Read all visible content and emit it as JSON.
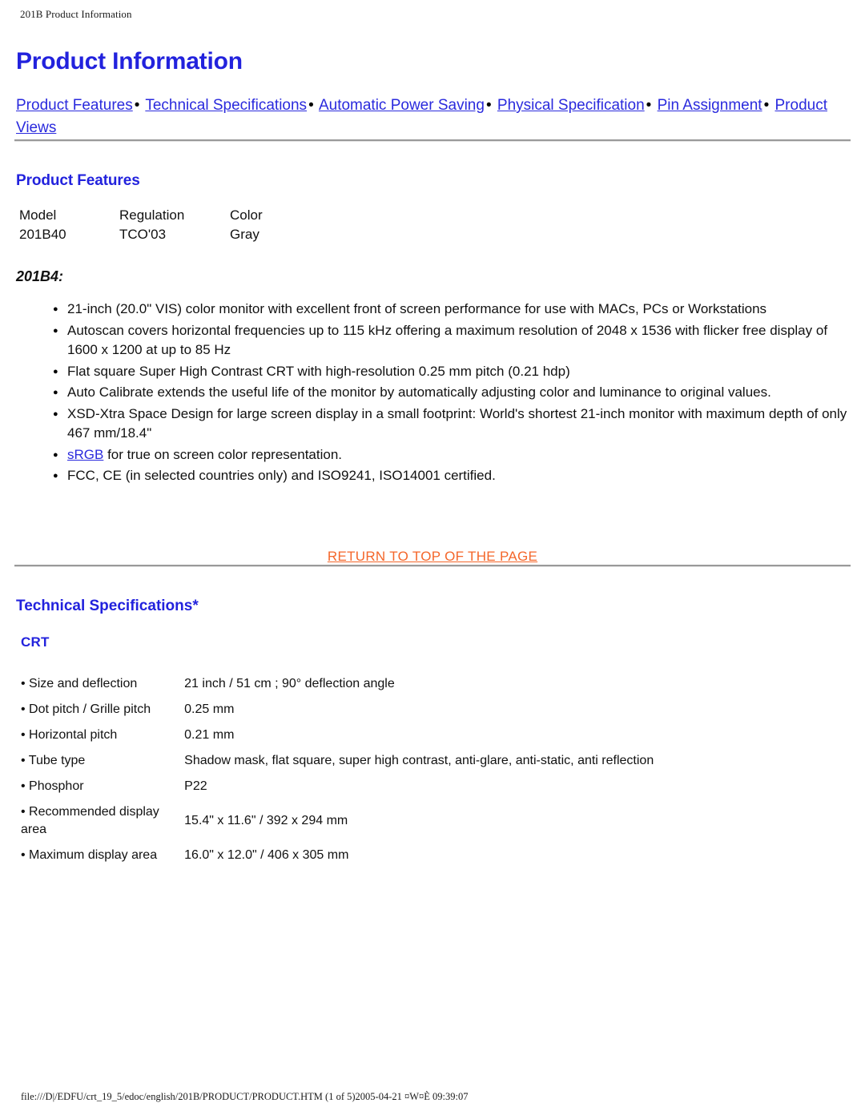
{
  "header": {
    "running_title": "201B Product Information"
  },
  "page": {
    "title": "Product Information"
  },
  "nav": {
    "separator": "•",
    "links": [
      {
        "label": "Product Features"
      },
      {
        "label": "Technical Specifications"
      },
      {
        "label": "Automatic Power Saving"
      },
      {
        "label": "Physical Specification"
      },
      {
        "label": "Pin Assignment"
      },
      {
        "label": "Product Views"
      }
    ]
  },
  "product_features": {
    "heading": "Product Features",
    "table": {
      "columns": [
        "Model",
        "Regulation",
        "Color"
      ],
      "rows": [
        [
          "201B40",
          "TCO'03",
          "Gray"
        ]
      ]
    },
    "model_label": "201B4:",
    "bullets": [
      {
        "text": "21-inch (20.0\" VIS) color monitor with excellent front of screen performance for use with MACs, PCs or Workstations"
      },
      {
        "text": "Autoscan covers horizontal frequencies up to 115 kHz offering a maximum resolution of 2048 x 1536 with flicker free display of 1600 x 1200 at up to 85 Hz"
      },
      {
        "text": "Flat square Super High Contrast CRT with high-resolution 0.25 mm pitch (0.21 hdp)"
      },
      {
        "text": "Auto Calibrate extends the useful life of the monitor by automatically adjusting color and luminance to original values."
      },
      {
        "text": "XSD-Xtra Space Design for large screen display in a small footprint: World's shortest 21-inch monitor with maximum depth of only 467 mm/18.4\""
      },
      {
        "link": "sRGB",
        "text": " for true on screen color representation."
      },
      {
        "text": "FCC, CE  (in selected countries only) and ISO9241, ISO14001 certified."
      }
    ]
  },
  "return_to_top": {
    "label": "RETURN TO TOP OF THE PAGE"
  },
  "technical_specifications": {
    "heading": "Technical Specifications*",
    "groups": [
      {
        "name": "CRT",
        "rows": [
          {
            "key": "• Size and deflection",
            "value": "21 inch / 51 cm ;    90° deflection angle"
          },
          {
            "key": "• Dot pitch / Grille pitch",
            "value": "0.25 mm"
          },
          {
            "key": "• Horizontal pitch",
            "value": "0.21 mm"
          },
          {
            "key": "• Tube type",
            "value": "Shadow mask, flat square, super high contrast, anti-glare, anti-static, anti reflection"
          },
          {
            "key": "• Phosphor",
            "value": "P22"
          },
          {
            "key": "• Recommended display area",
            "value": "15.4\" x 11.6\" / 392 x 294 mm"
          },
          {
            "key": "• Maximum display area",
            "value": "16.0\" x 12.0\" / 406 x 305 mm"
          }
        ]
      }
    ]
  },
  "footer": {
    "path_status": "file:///D|/EDFU/crt_19_5/edoc/english/201B/PRODUCT/PRODUCT.HTM (1 of 5)2005-04-21 ¤W¤È 09:39:07"
  },
  "colors": {
    "link_blue": "#2a2add",
    "heading_blue": "#2222dd",
    "return_orange": "#f4662a",
    "rule_gray": "#9a9a9a"
  }
}
